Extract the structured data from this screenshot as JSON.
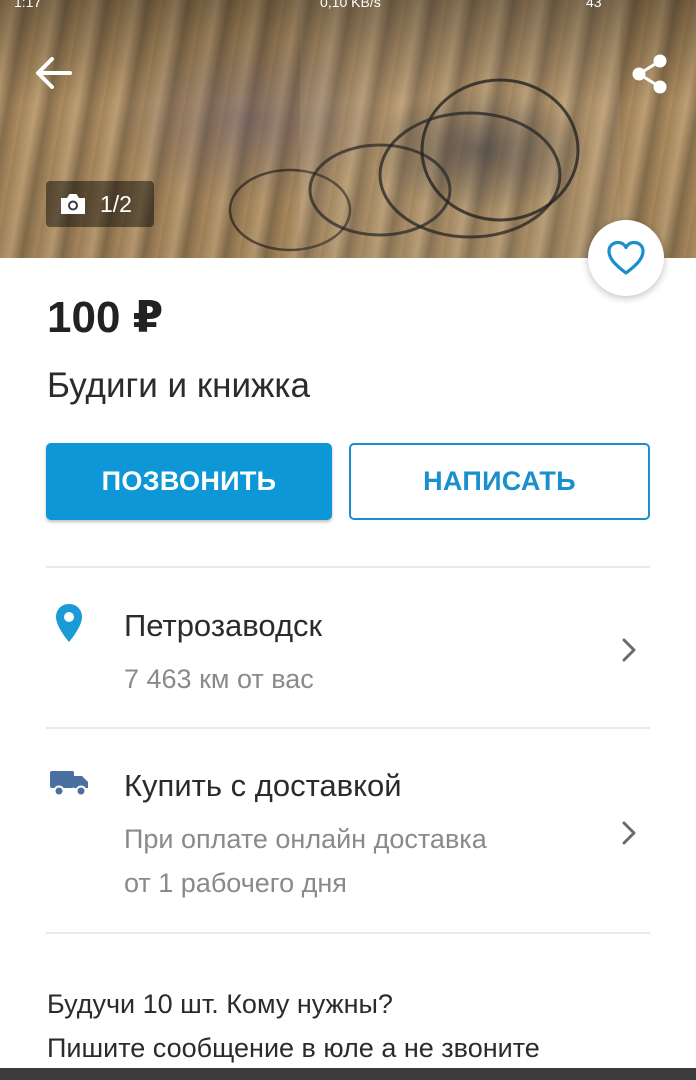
{
  "status_bar": {
    "time": "1:17",
    "speed": "0,10 KB/s",
    "battery": "43"
  },
  "photo": {
    "counter": "1/2"
  },
  "listing": {
    "price": "100 ₽",
    "title": "Будиги и книжка"
  },
  "actions": {
    "call_label": "ПОЗВОНИТЬ",
    "write_label": "НАПИСАТЬ"
  },
  "location": {
    "city": "Петрозаводск",
    "distance": "7 463 км от вас"
  },
  "delivery": {
    "title": "Купить с доставкой",
    "line1": "При оплате онлайн доставка",
    "line2": "от 1 рабочего дня"
  },
  "description": {
    "line1": "Будучи 10 шт. Кому нужны?",
    "line2": "Пишите сообщение в юле а не звоните"
  },
  "colors": {
    "accent": "#0e97d6",
    "accent_dark": "#1a8fce",
    "icon_blue": "#1a9ad6",
    "truck": "#4a6fa1",
    "muted_text": "#8a8a8a"
  },
  "icons": {
    "back": "arrow-left-icon",
    "share": "share-icon",
    "camera": "camera-icon",
    "favorite": "heart-icon",
    "location": "location-pin-icon",
    "delivery": "truck-icon",
    "chevron": "chevron-right-icon"
  }
}
